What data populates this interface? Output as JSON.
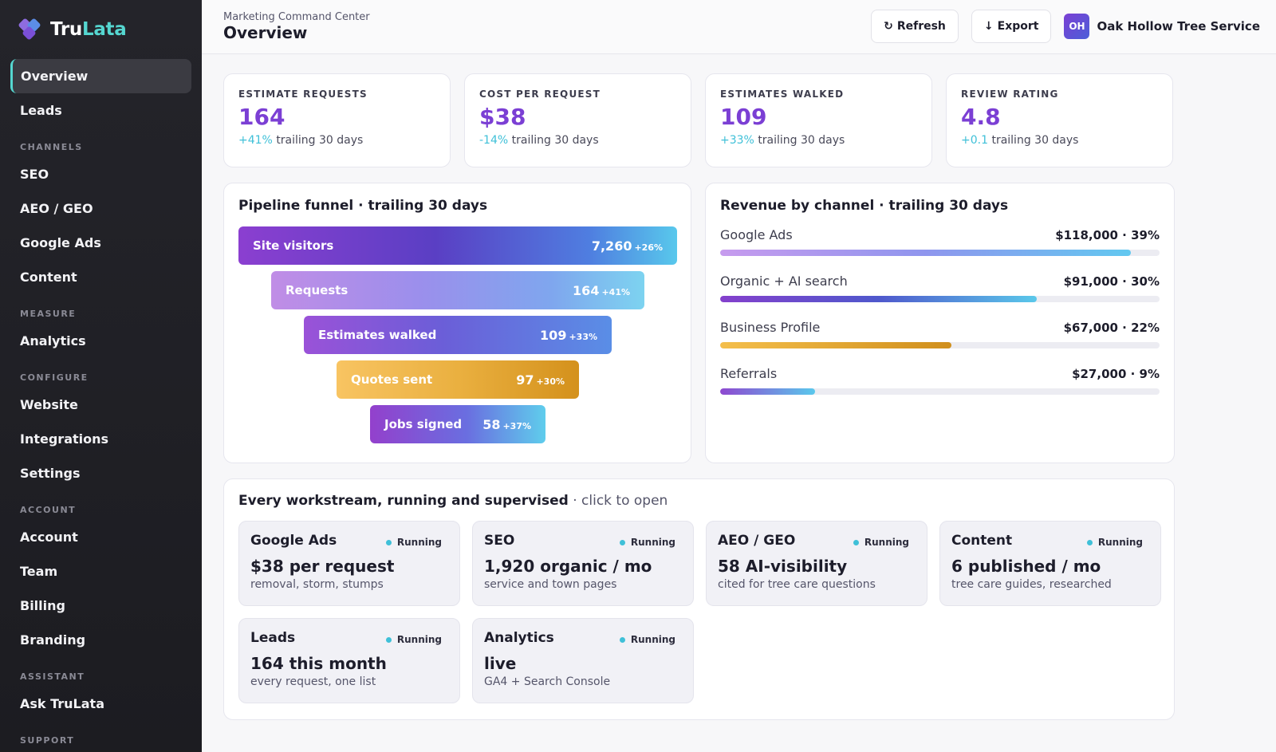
{
  "brand": {
    "name_a": "Tru",
    "name_b": "Lata"
  },
  "sidebar": {
    "items": [
      {
        "label": "Overview"
      },
      {
        "label": "Leads"
      }
    ],
    "sections": [
      {
        "title": "CHANNELS",
        "items": [
          {
            "label": "SEO"
          },
          {
            "label": "AEO / GEO"
          },
          {
            "label": "Google Ads"
          },
          {
            "label": "Content"
          }
        ]
      },
      {
        "title": "MEASURE",
        "items": [
          {
            "label": "Analytics"
          }
        ]
      },
      {
        "title": "CONFIGURE",
        "items": [
          {
            "label": "Website"
          },
          {
            "label": "Integrations"
          },
          {
            "label": "Settings"
          }
        ]
      },
      {
        "title": "ACCOUNT",
        "items": [
          {
            "label": "Account"
          },
          {
            "label": "Team"
          },
          {
            "label": "Billing"
          },
          {
            "label": "Branding"
          }
        ]
      },
      {
        "title": "ASSISTANT",
        "items": [
          {
            "label": "Ask TruLata"
          }
        ]
      },
      {
        "title": "SUPPORT",
        "items": []
      }
    ]
  },
  "header": {
    "breadcrumb": "Marketing Command Center",
    "title": "Overview",
    "refresh_label": "Refresh",
    "export_label": "Export",
    "org_initials": "OH",
    "org_name": "Oak Hollow Tree Service"
  },
  "stats": [
    {
      "label": "ESTIMATE REQUESTS",
      "value": "164",
      "delta": "+41%",
      "period": "trailing 30 days"
    },
    {
      "label": "COST PER REQUEST",
      "value": "$38",
      "delta": "-14%",
      "period": "trailing 30 days"
    },
    {
      "label": "ESTIMATES WALKED",
      "value": "109",
      "delta": "+33%",
      "period": "trailing 30 days"
    },
    {
      "label": "REVIEW RATING",
      "value": "4.8",
      "delta": "+0.1",
      "period": "trailing 30 days"
    }
  ],
  "funnel": {
    "title": "Pipeline funnel · trailing 30 days",
    "stages": [
      {
        "label": "Site visitors",
        "value": "7,260",
        "delta": "+26%"
      },
      {
        "label": "Requests",
        "value": "164",
        "delta": "+41%"
      },
      {
        "label": "Estimates walked",
        "value": "109",
        "delta": "+33%"
      },
      {
        "label": "Quotes sent",
        "value": "97",
        "delta": "+30%"
      },
      {
        "label": "Jobs signed",
        "value": "58",
        "delta": "+37%"
      }
    ]
  },
  "revenue": {
    "title": "Revenue by channel · trailing 30 days",
    "channels": [
      {
        "name": "Google Ads",
        "amount": "$118,000 · 39%",
        "share": 0.935
      },
      {
        "name": "Organic + AI search",
        "amount": "$91,000 · 30%",
        "share": 0.72
      },
      {
        "name": "Business Profile",
        "amount": "$67,000 · 22%",
        "share": 0.527
      },
      {
        "name": "Referrals",
        "amount": "$27,000 · 9%",
        "share": 0.216
      }
    ]
  },
  "workstreams": {
    "title": "Every workstream, running and supervised",
    "hint": " · click to open",
    "items": [
      {
        "name": "Google Ads",
        "status": "Running",
        "value": "$38 per request",
        "sub": "removal, storm, stumps"
      },
      {
        "name": "SEO",
        "status": "Running",
        "value": "1,920 organic / mo",
        "sub": "service and town pages"
      },
      {
        "name": "AEO / GEO",
        "status": "Running",
        "value": "58 AI-visibility",
        "sub": "cited for tree care questions"
      },
      {
        "name": "Content",
        "status": "Running",
        "value": "6 published / mo",
        "sub": "tree care guides, researched"
      },
      {
        "name": "Leads",
        "status": "Running",
        "value": "164 this month",
        "sub": "every request, one list"
      },
      {
        "name": "Analytics",
        "status": "Running",
        "value": "live",
        "sub": "GA4 + Search Console"
      }
    ]
  },
  "colors": {
    "accent": "#7b3fd4",
    "positive": "#3fc0d8",
    "sidebar_bg": "#24242a"
  }
}
